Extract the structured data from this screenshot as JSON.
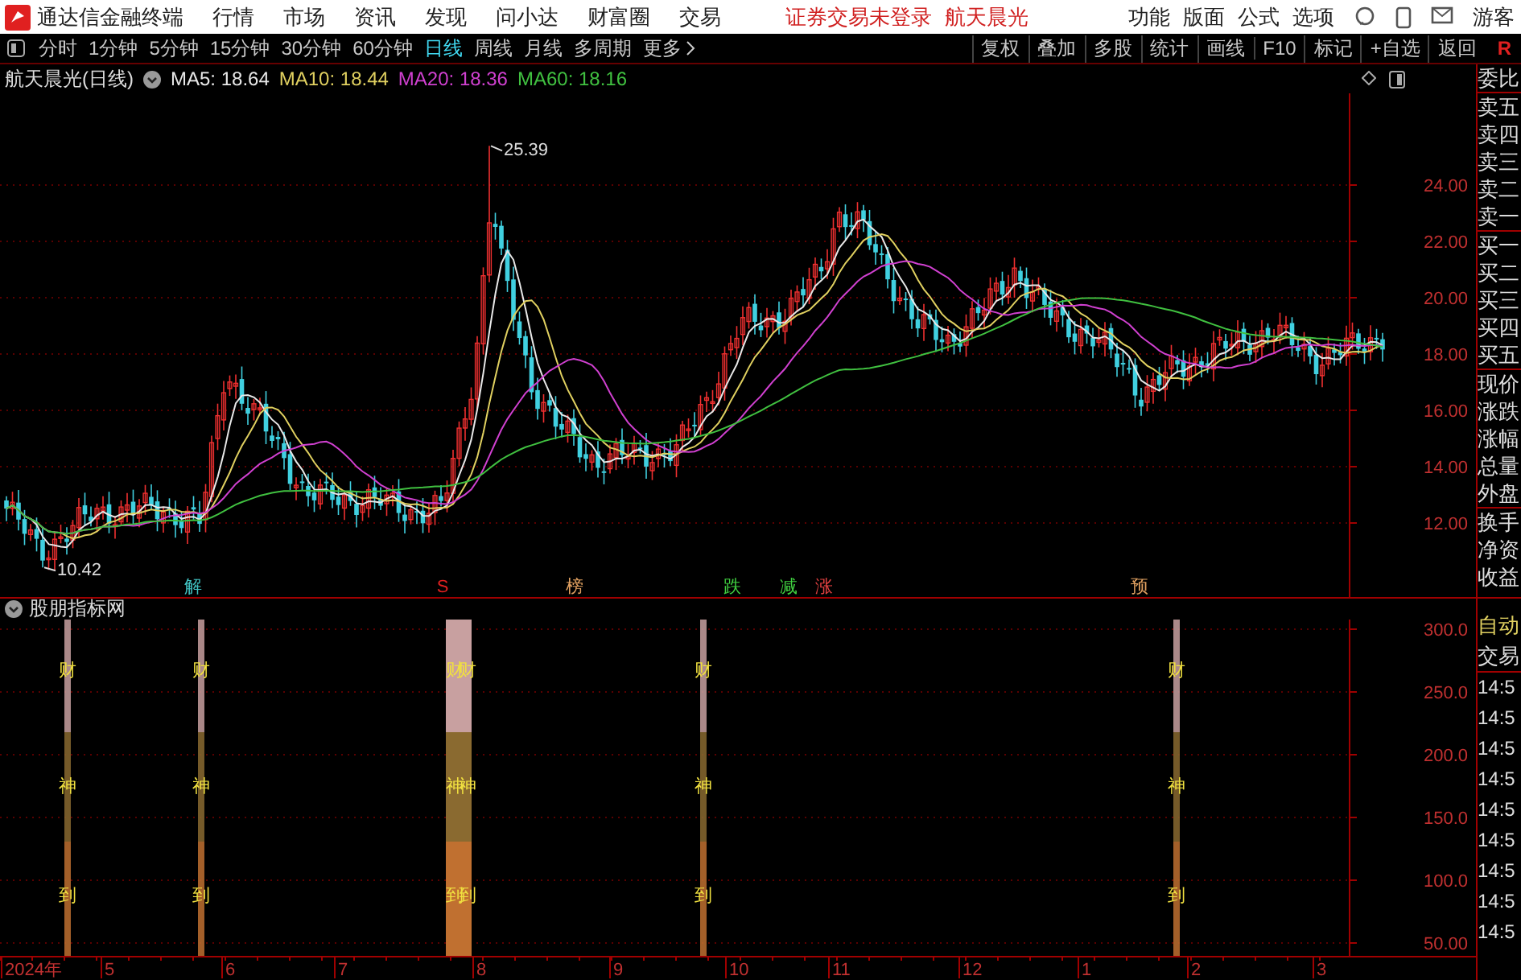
{
  "app": {
    "title": "通达信金融终端"
  },
  "menu": [
    "行情",
    "市场",
    "资讯",
    "发现",
    "问小达",
    "财富圈",
    "交易"
  ],
  "status": {
    "login": "证券交易未登录",
    "stock": "航天晨光"
  },
  "tools": [
    "功能",
    "版面",
    "公式",
    "选项"
  ],
  "user": "游客",
  "periods": [
    {
      "label": "分时",
      "selected": false
    },
    {
      "label": "1分钟",
      "selected": false
    },
    {
      "label": "5分钟",
      "selected": false
    },
    {
      "label": "15分钟",
      "selected": false
    },
    {
      "label": "30分钟",
      "selected": false
    },
    {
      "label": "60分钟",
      "selected": false
    },
    {
      "label": "日线",
      "selected": true
    },
    {
      "label": "周线",
      "selected": false
    },
    {
      "label": "月线",
      "selected": false
    },
    {
      "label": "多周期",
      "selected": false
    },
    {
      "label": "更多",
      "selected": false
    }
  ],
  "chart_buttons": [
    "复权",
    "叠加",
    "多股",
    "统计",
    "画线",
    "F10",
    "标记",
    "+自选",
    "返回"
  ],
  "corner_mark": "R",
  "main_chart": {
    "title": "航天晨光(日线)",
    "ma": [
      {
        "label": "MA5: 18.64",
        "color": "#e8e8e8"
      },
      {
        "label": "MA10: 18.44",
        "color": "#e0d060"
      },
      {
        "label": "MA20: 18.36",
        "color": "#d040d0"
      },
      {
        "label": "MA60: 18.16",
        "color": "#40c040"
      }
    ],
    "high_label": "25.39",
    "low_label": "10.42",
    "y_ticks": [
      "24.00",
      "22.00",
      "20.00",
      "18.00",
      "16.00",
      "14.00",
      "12.00"
    ],
    "markers": [
      {
        "text": "解",
        "color": "#40c0c0"
      },
      {
        "text": "S",
        "color": "#e02020"
      },
      {
        "text": "榜",
        "color": "#e0a060"
      },
      {
        "text": "跌",
        "color": "#40d040"
      },
      {
        "text": "减",
        "color": "#40d040"
      },
      {
        "text": "涨",
        "color": "#e04040"
      },
      {
        "text": "预",
        "color": "#e0a060"
      }
    ]
  },
  "indicator": {
    "title": "股朋指标网",
    "y_ticks": [
      "300.0",
      "250.0",
      "200.0",
      "150.0",
      "100.0",
      "50.00"
    ],
    "signals": [
      {
        "kind": "single",
        "texts": [
          "财",
          "神",
          "到"
        ]
      },
      {
        "kind": "single",
        "texts": [
          "财",
          "神",
          "到"
        ]
      },
      {
        "kind": "wide",
        "texts": [
          "财财",
          "神神",
          "到到"
        ]
      },
      {
        "kind": "single",
        "texts": [
          "财",
          "神",
          "到"
        ]
      },
      {
        "kind": "single",
        "texts": [
          "财",
          "神",
          "到"
        ]
      }
    ]
  },
  "date_axis": [
    "2024年",
    "5",
    "6",
    "7",
    "8",
    "9",
    "10",
    "11",
    "12",
    "1",
    "2",
    "3"
  ],
  "quote_panel": [
    [
      "委比"
    ],
    [
      "卖五",
      "卖四",
      "卖三",
      "卖二",
      "卖一"
    ],
    [
      "买一",
      "买二",
      "买三",
      "买四",
      "买五"
    ],
    [
      "现价",
      "涨跌",
      "涨幅",
      "总量",
      "外盘"
    ],
    [
      "换手",
      "净资",
      "收益"
    ]
  ],
  "trade_panel": {
    "mode": "自动",
    "title": "交易",
    "times": [
      "14:5",
      "14:5",
      "14:5",
      "14:5",
      "14:5",
      "14:5",
      "14:5",
      "14:5",
      "14:5"
    ]
  }
}
